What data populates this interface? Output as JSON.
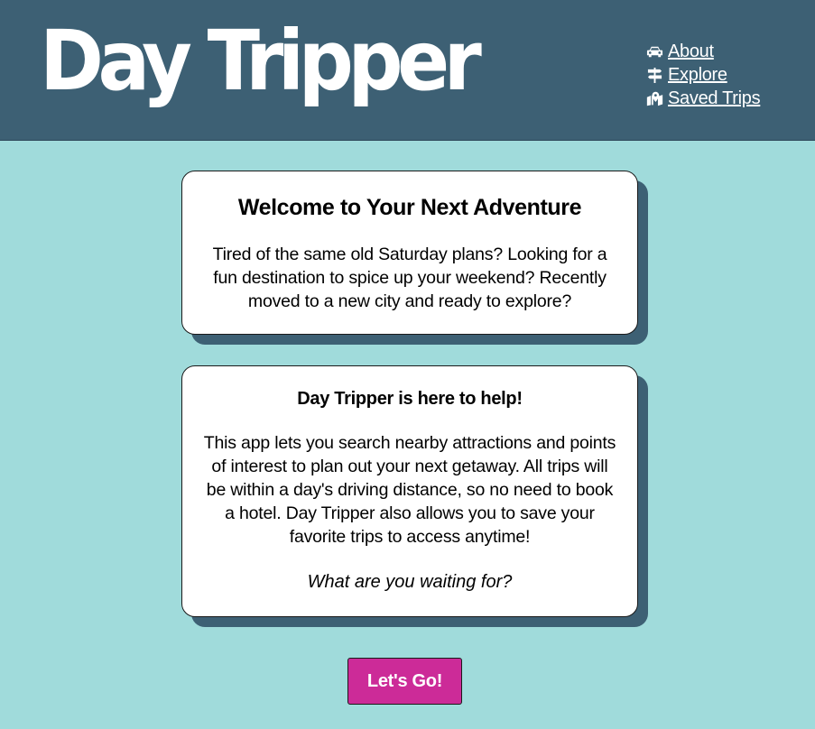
{
  "header": {
    "logo_text": "Day Tripper",
    "nav": [
      {
        "label": "About",
        "icon": "car-icon"
      },
      {
        "label": "Explore",
        "icon": "signpost-icon"
      },
      {
        "label": "Saved Trips",
        "icon": "map-marker-icon"
      }
    ]
  },
  "welcome_card": {
    "title": "Welcome to Your Next Adventure",
    "text": "Tired of the same old Saturday plans? Looking for a fun destination to spice up your weekend? Recently moved to a new city and ready to explore?"
  },
  "help_card": {
    "title": "Day Tripper is here to help!",
    "text": "This app lets you search nearby attractions and points of interest to plan out your next getaway. All trips will be within a day's driving distance, so no need to book a hotel. Day Tripper also allows you to save your favorite trips to access anytime!",
    "cta_prompt": "What are you waiting for?"
  },
  "cta_button": {
    "label": "Let's Go!"
  },
  "colors": {
    "header_bg": "#3d6074",
    "page_bg": "#a0dbdb",
    "button_bg": "#cc2b98",
    "card_shadow": "#3d6074"
  }
}
